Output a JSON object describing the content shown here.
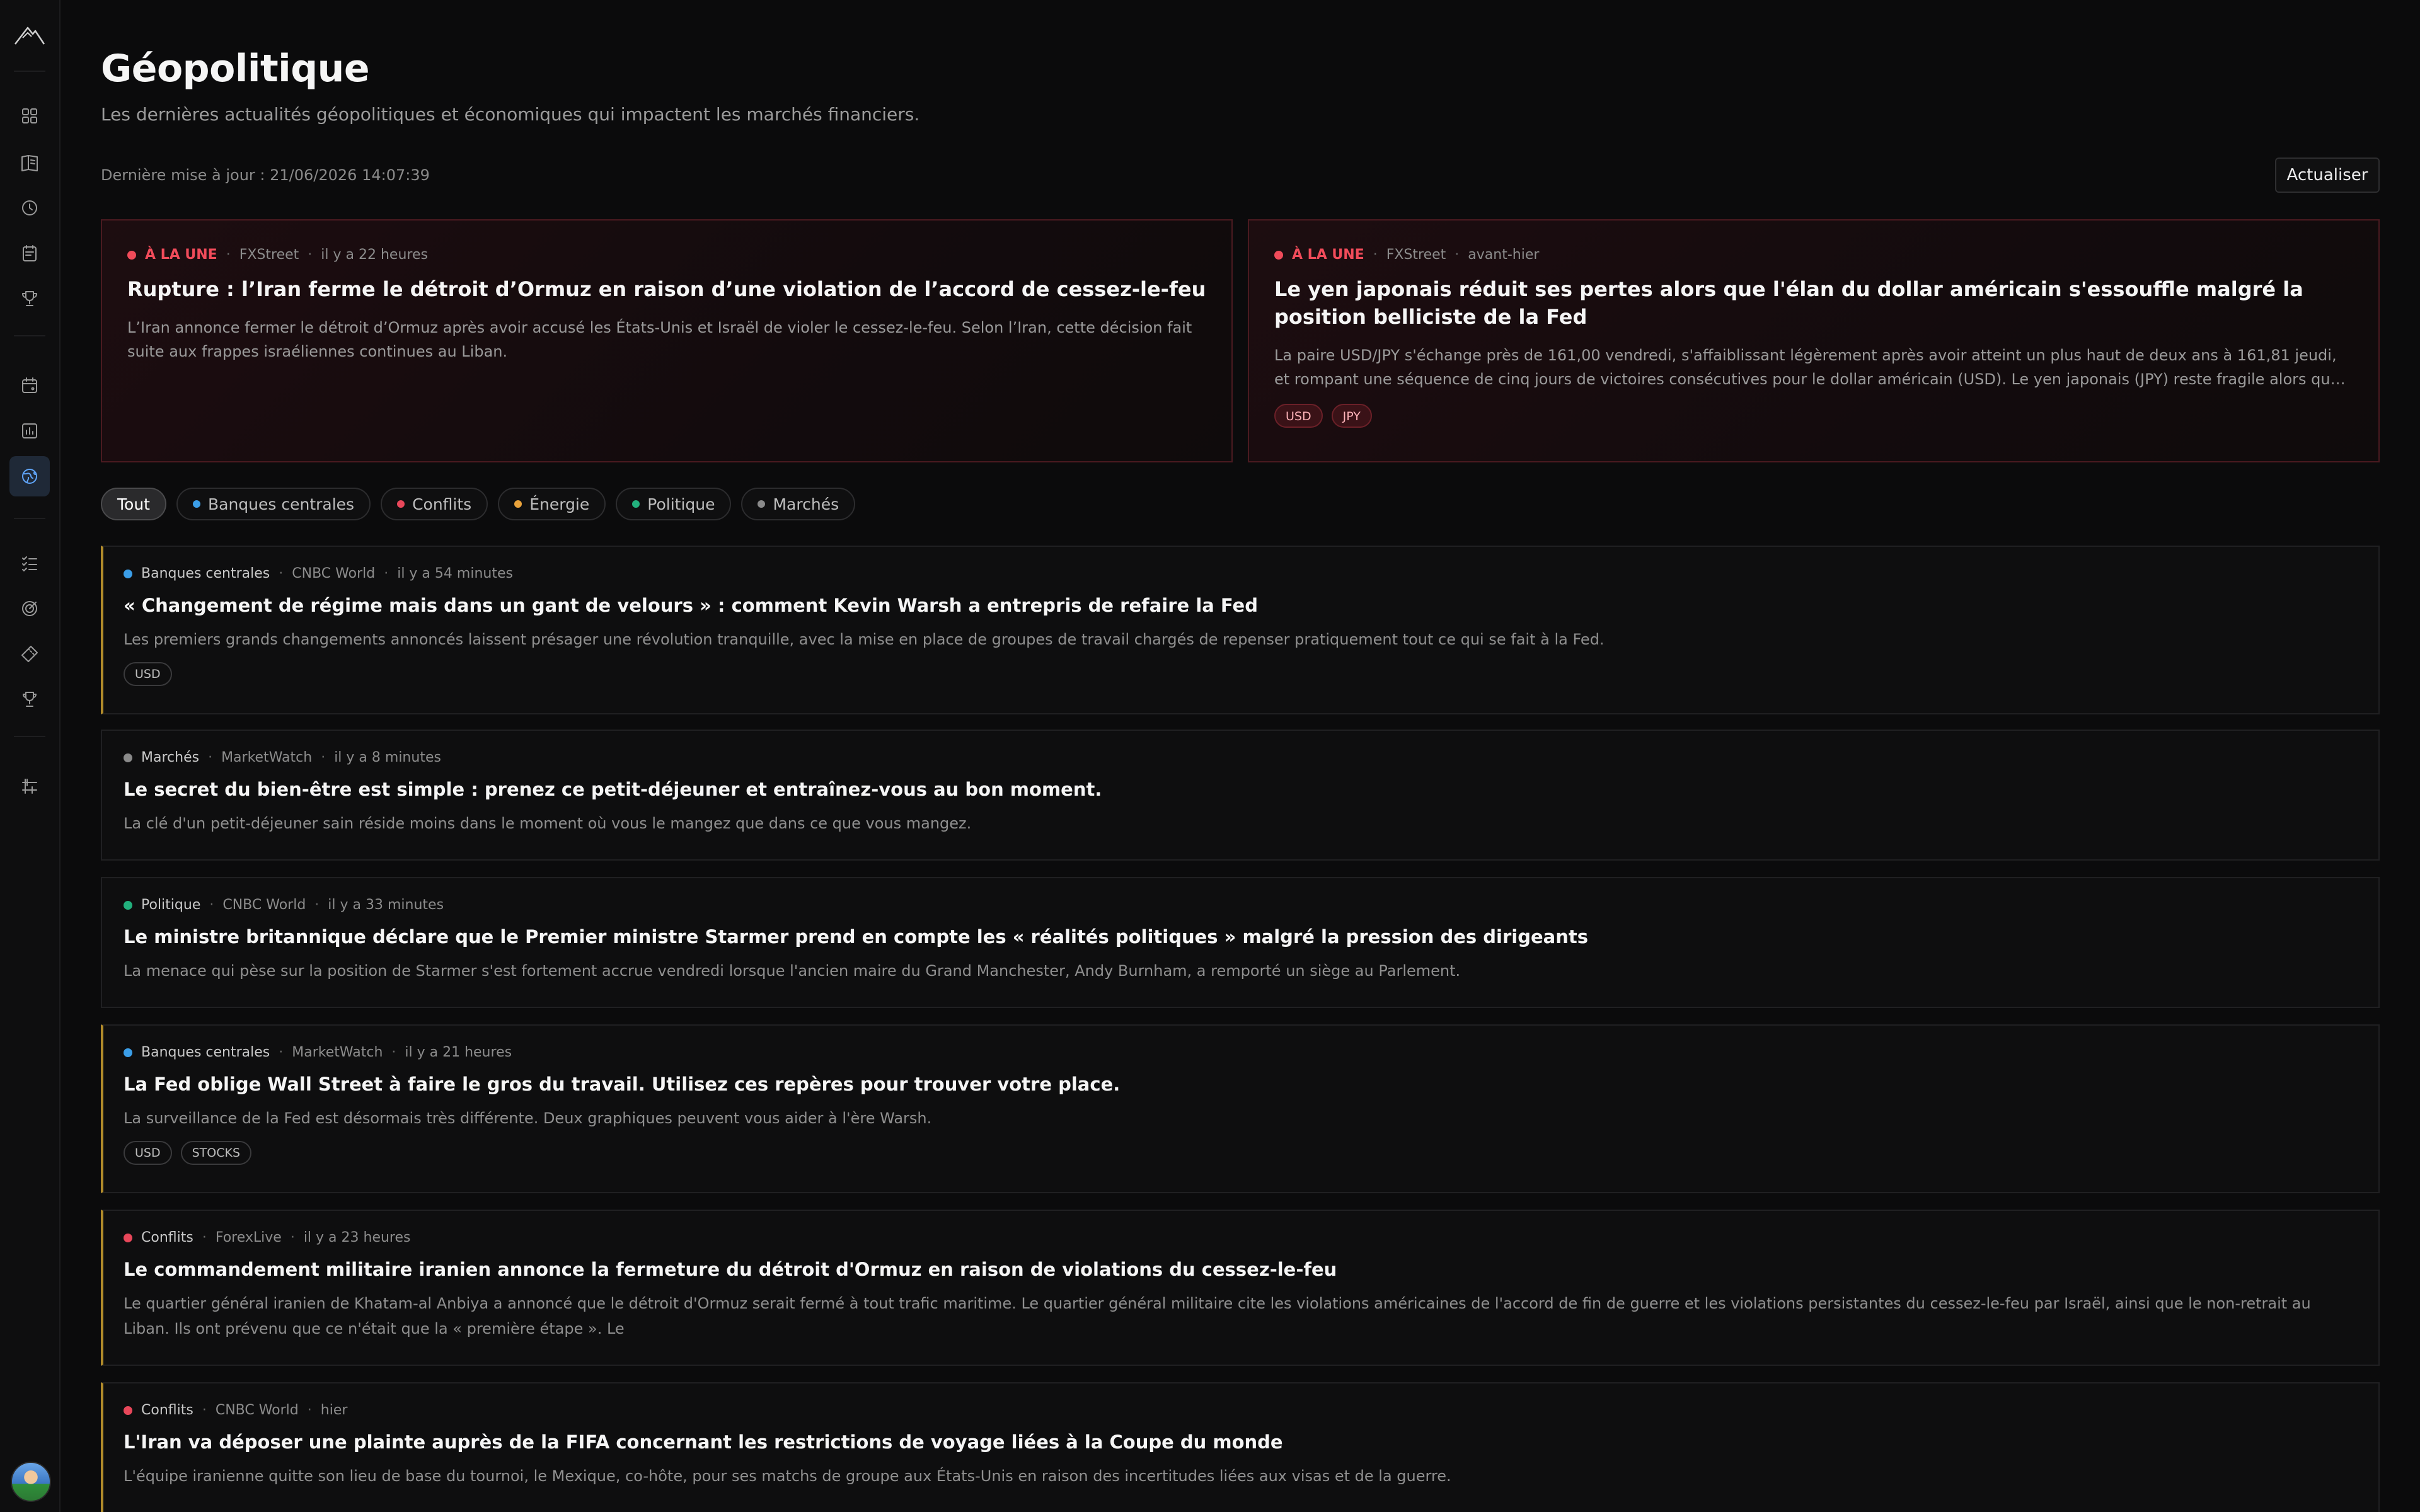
{
  "header": {
    "title": "Géopolitique",
    "subtitle": "Les dernières actualités géopolitiques et économiques qui impactent les marchés financiers.",
    "last_update": "Dernière mise à jour : 21/06/2026 14:07:39",
    "refresh_label": "Actualiser"
  },
  "sidebar": {
    "icons": [
      "logo-mountain-icon",
      "dashboard-icon",
      "journal-icon",
      "history-icon",
      "calendar-clipboard-icon",
      "trophy-icon",
      "calendar-icon",
      "chart-icon",
      "globe-icon",
      "checklist-icon",
      "target-icon",
      "ticket-icon",
      "award-icon",
      "settings-sliders-icon"
    ],
    "active": "globe-icon"
  },
  "featured": [
    {
      "badge": "À LA UNE",
      "source": "FXStreet",
      "time": "il y a 22 heures",
      "title": "Rupture : l’Iran ferme le détroit d’Ormuz en raison d’une violation de l’accord de cessez-le-feu",
      "summary": "L’Iran annonce fermer le détroit d’Ormuz après avoir accusé les États-Unis et Israël de violer le cessez-le-feu. Selon l’Iran, cette décision fait suite aux frappes israéliennes continues au Liban.",
      "tags": []
    },
    {
      "badge": "À LA UNE",
      "source": "FXStreet",
      "time": "avant-hier",
      "title": "Le yen japonais réduit ses pertes alors que l'élan du dollar américain s'essouffle malgré la position belliciste de la Fed",
      "summary": "La paire USD/JPY s'échange près de 161,00 vendredi, s'affaiblissant légèrement après avoir atteint un plus haut de deux ans à 161,81 jeudi, et rompant une séquence de cinq jours de victoires consécutives pour le dollar américain (USD). Le yen japonais (JPY) reste fragile alors que la pression monte sur une intervention…",
      "tags": [
        "USD",
        "JPY"
      ]
    }
  ],
  "filters": [
    {
      "label": "Tout",
      "color": null,
      "active": true
    },
    {
      "label": "Banques centrales",
      "color": "#3b9ee8"
    },
    {
      "label": "Conflits",
      "color": "#e8475a"
    },
    {
      "label": "Énergie",
      "color": "#e8a23b"
    },
    {
      "label": "Politique",
      "color": "#22b07d"
    },
    {
      "label": "Marchés",
      "color": "#8a8a8a"
    }
  ],
  "news": [
    {
      "category": "Banques centrales",
      "color": "#3b9ee8",
      "source": "CNBC World",
      "time": "il y a 54 minutes",
      "title": "« Changement de régime mais dans un gant de velours » : comment Kevin Warsh a entrepris de refaire la Fed",
      "summary": "Les premiers grands changements annoncés laissent présager une révolution tranquille, avec la mise en place de groupes de travail chargés de repenser pratiquement tout ce qui se fait à la Fed.",
      "tags": [
        "USD"
      ]
    },
    {
      "category": "Marchés",
      "color": "#8a8a8a",
      "source": "MarketWatch",
      "time": "il y a 8 minutes",
      "title": "Le secret du bien-être est simple : prenez ce petit-déjeuner et entraînez-vous au bon moment.",
      "summary": "La clé d'un petit-déjeuner sain réside moins dans le moment où vous le mangez que dans ce que vous mangez.",
      "tags": []
    },
    {
      "category": "Politique",
      "color": "#22b07d",
      "source": "CNBC World",
      "time": "il y a 33 minutes",
      "title": "Le ministre britannique déclare que le Premier ministre Starmer prend en compte les « réalités politiques » malgré la pression des dirigeants",
      "summary": "La menace qui pèse sur la position de Starmer s'est fortement accrue vendredi lorsque l'ancien maire du Grand Manchester, Andy Burnham, a remporté un siège au Parlement.",
      "tags": []
    },
    {
      "category": "Banques centrales",
      "color": "#3b9ee8",
      "source": "MarketWatch",
      "time": "il y a 21 heures",
      "title": "La Fed oblige Wall Street à faire le gros du travail. Utilisez ces repères pour trouver votre place.",
      "summary": "La surveillance de la Fed est désormais très différente. Deux graphiques peuvent vous aider à l'ère Warsh.",
      "tags": [
        "USD",
        "STOCKS"
      ]
    },
    {
      "category": "Conflits",
      "color": "#e8475a",
      "source": "ForexLive",
      "time": "il y a 23 heures",
      "title": "Le commandement militaire iranien annonce la fermeture du détroit d'Ormuz en raison de violations du cessez-le-feu",
      "summary": "Le quartier général iranien de Khatam-al Anbiya a annoncé que le détroit d'Ormuz serait fermé à tout trafic maritime. Le quartier général militaire cite les violations américaines de l'accord de fin de guerre et les violations persistantes du cessez-le-feu par Israël, ainsi que le non-retrait au Liban. Ils ont prévenu que ce n'était que la « première étape ». Le",
      "tags": []
    },
    {
      "category": "Conflits",
      "color": "#e8475a",
      "source": "CNBC World",
      "time": "hier",
      "title": "L'Iran va déposer une plainte auprès de la FIFA concernant les restrictions de voyage liées à la Coupe du monde",
      "summary": "L'équipe iranienne quitte son lieu de base du tournoi, le Mexique, co-hôte, pour ses matchs de groupe aux États-Unis en raison des incertitudes liées aux visas et de la guerre.",
      "tags": []
    }
  ]
}
